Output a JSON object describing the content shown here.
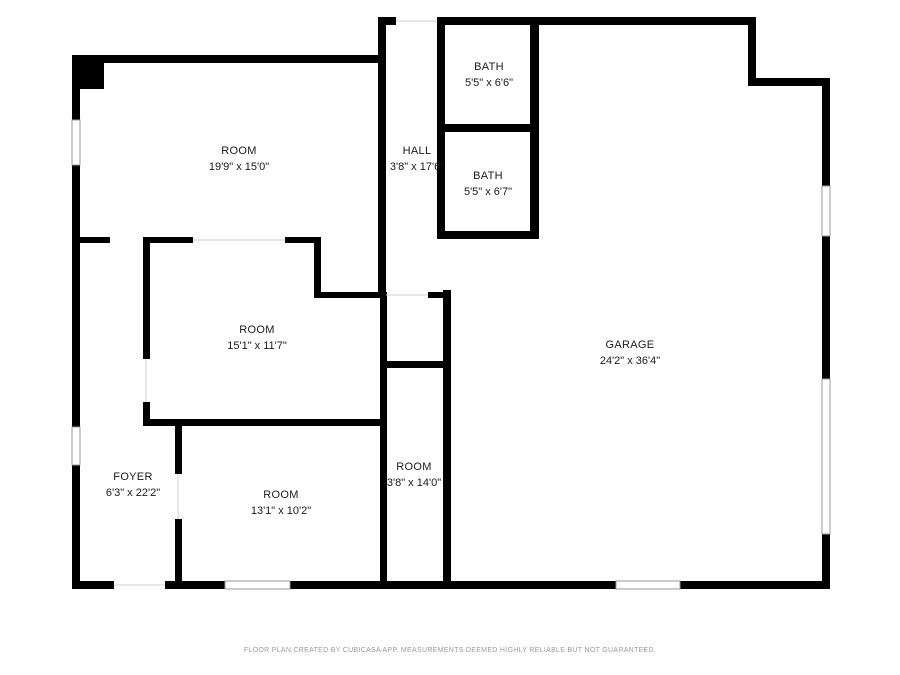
{
  "rooms": {
    "room_top_left": {
      "name": "ROOM",
      "dims": "19'9\" x 15'0\""
    },
    "room_middle": {
      "name": "ROOM",
      "dims": "15'1\" x 11'7\""
    },
    "room_bottom": {
      "name": "ROOM",
      "dims": "13'1\" x 10'2\""
    },
    "room_narrow": {
      "name": "ROOM",
      "dims": "3'8\" x 14'0\""
    },
    "foyer": {
      "name": "FOYER",
      "dims": "6'3\" x 22'2\""
    },
    "hall": {
      "name": "HALL",
      "dims": "3'8\" x 17'6\""
    },
    "bath_upper": {
      "name": "BATH",
      "dims": "5'5\" x 6'6\""
    },
    "bath_lower": {
      "name": "BATH",
      "dims": "5'5\" x 6'7\""
    },
    "garage": {
      "name": "GARAGE",
      "dims": "24'2\" x 36'4\""
    }
  },
  "footer": {
    "note": "FLOOR PLAN CREATED BY CUBICASA APP. MEASUREMENTS DEEMED HIGHLY RELIABLE BUT NOT GUARANTEED."
  },
  "colors": {
    "wall": "#000000",
    "window": "#9a9a9a",
    "background": "#ffffff"
  }
}
